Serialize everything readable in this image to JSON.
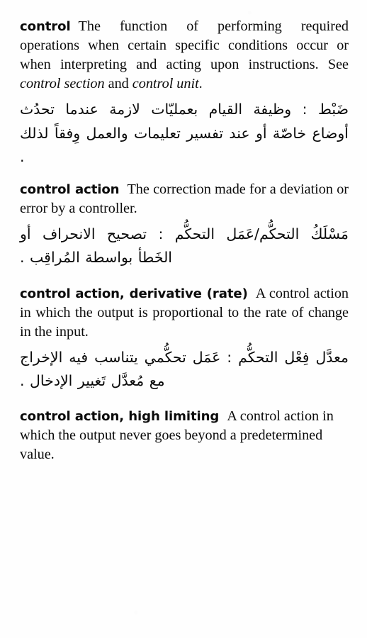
{
  "page": {
    "language_pair": "English–Arabic",
    "entries": [
      {
        "headword": "control",
        "definition_before_xref": "The function of performing required operations when certain specific conditions occur or when interpreting and acting upon instructions. See ",
        "xref_1": "control section",
        "conjunction": " and ",
        "xref_2": "control unit",
        "definition_end": ".",
        "arabic": "ضَبْط : وظيفة القيام بعمليّات لازمة عندما تحدُث أوضاع خاصّة أو عند تفسير تعليمات والعمل وِفقاً لذلك ."
      },
      {
        "headword": "control action",
        "definition": "The correction made for a deviation or error by a controller.",
        "arabic": "مَسْلَكُ التحكُّم/عَمَل التحكُّم : تصحيح الانحراف أو الخَطأ بواسطة المُراقِب ."
      },
      {
        "headword": "control action, derivative (rate)",
        "definition": "A control action in which the output is proportional to the rate of change in the input.",
        "arabic": "معدَّل فِعْل التحكُّم : عَمَل تحكُّمي يتناسب فيه الإخراج مع مُعدَّل تَغيير الإدخال ."
      },
      {
        "headword": "control action, high limiting",
        "definition": "A control action in which the output never goes beyond a predetermined value.",
        "arabic": ""
      }
    ]
  }
}
